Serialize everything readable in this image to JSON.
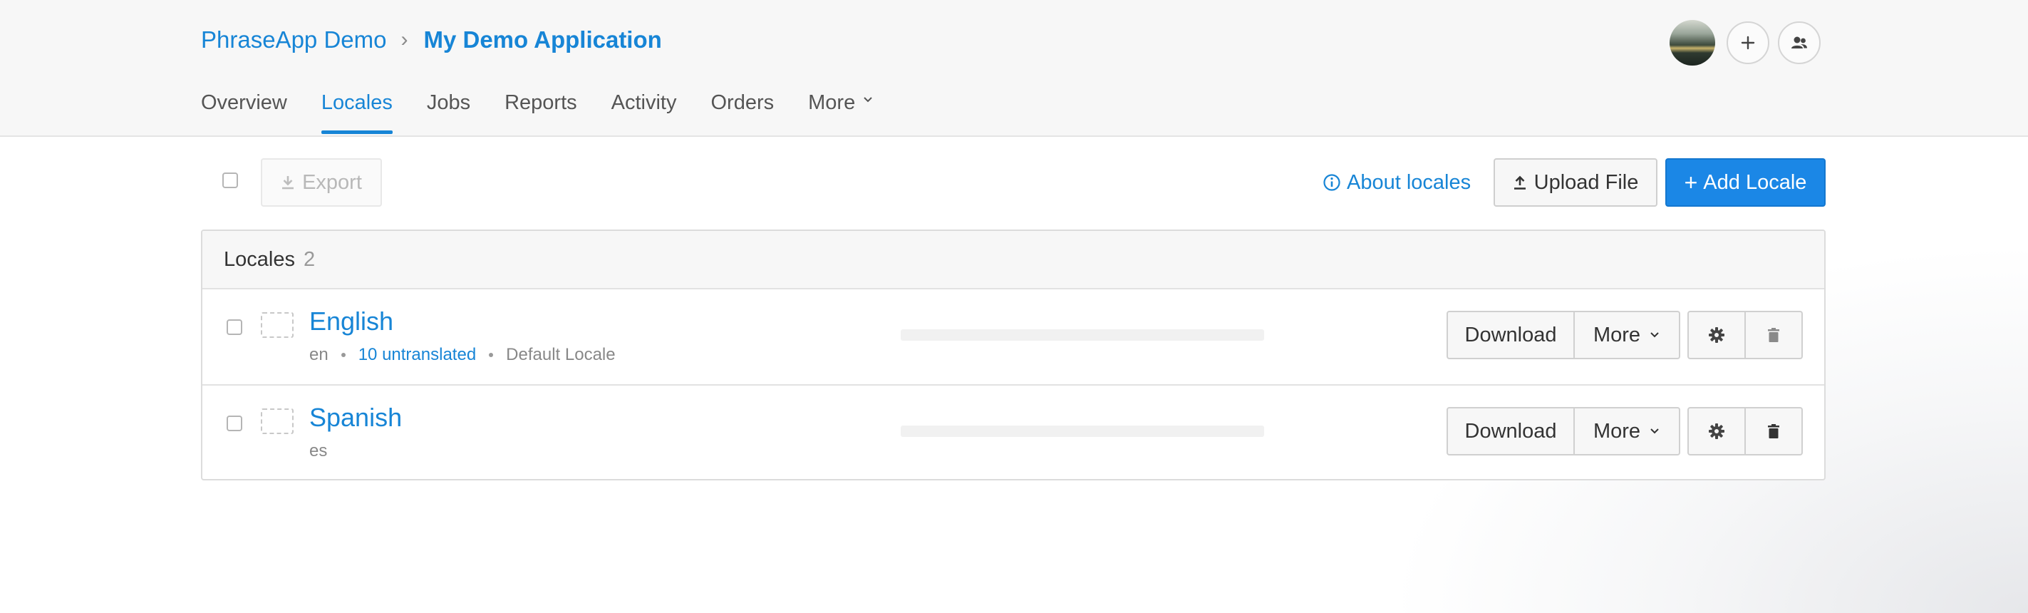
{
  "breadcrumb": {
    "organization": "PhraseApp Demo",
    "separator": "›",
    "project": "My Demo Application"
  },
  "header_actions": {
    "avatar": "user-avatar",
    "add_icon": "plus-icon",
    "members_icon": "add-user-icon"
  },
  "tabs": [
    {
      "label": "Overview",
      "active": false
    },
    {
      "label": "Locales",
      "active": true
    },
    {
      "label": "Jobs",
      "active": false
    },
    {
      "label": "Reports",
      "active": false
    },
    {
      "label": "Activity",
      "active": false
    },
    {
      "label": "Orders",
      "active": false
    },
    {
      "label": "More",
      "active": false
    }
  ],
  "toolbar": {
    "export_label": "Export",
    "about_label": "About locales",
    "upload_label": "Upload File",
    "add_label": "Add Locale"
  },
  "panel": {
    "title": "Locales",
    "count": "2"
  },
  "locales": [
    {
      "name": "English",
      "code": "en",
      "untranslated": "10 untranslated",
      "default": "Default Locale",
      "progress": 0,
      "download_label": "Download",
      "more_label": "More"
    },
    {
      "name": "Spanish",
      "code": "es",
      "progress": 0,
      "download_label": "Download",
      "more_label": "More"
    }
  ],
  "colors": {
    "accent": "#1785d6",
    "primary_button": "#1b87e6",
    "header_bg": "#f7f7f7"
  }
}
